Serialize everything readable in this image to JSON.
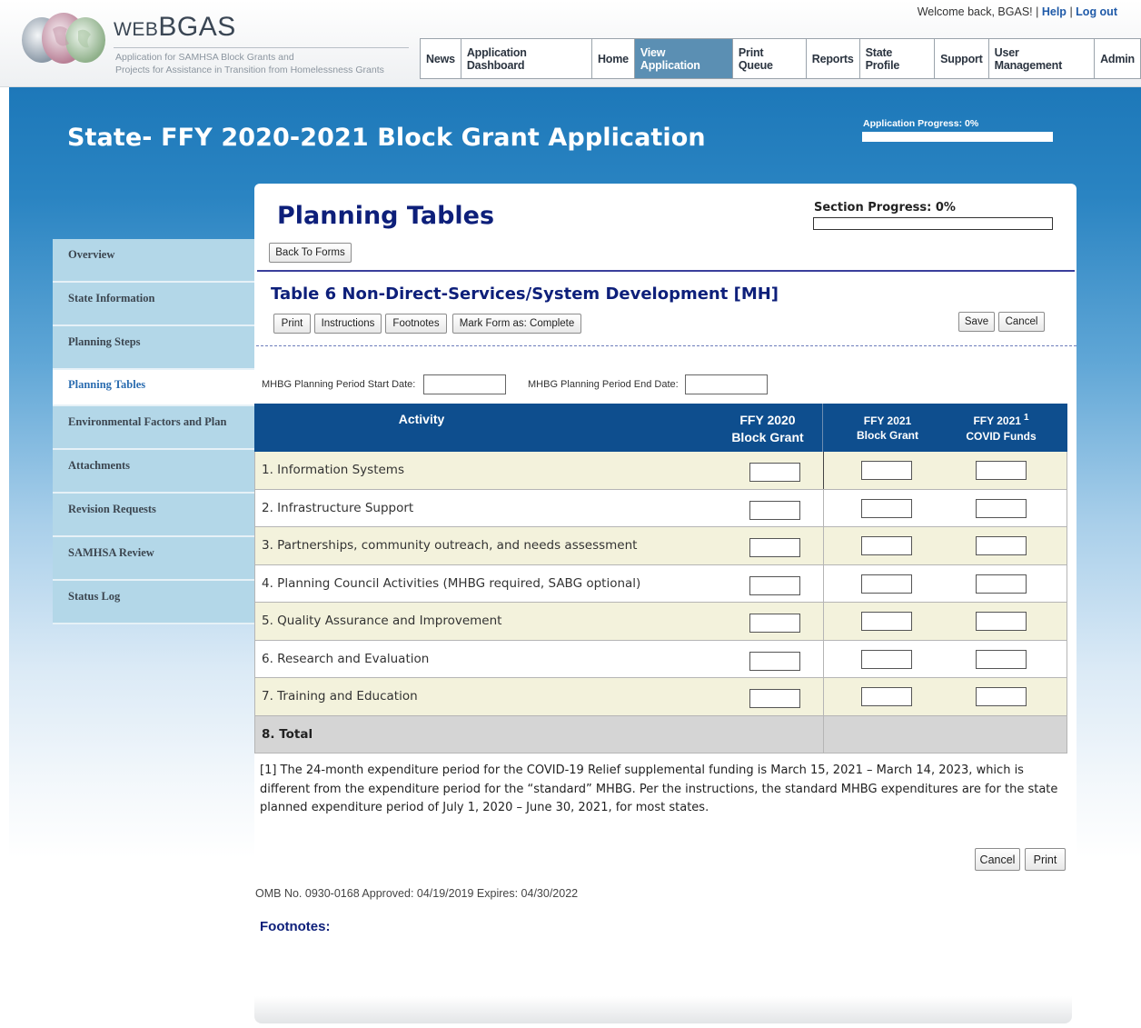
{
  "header": {
    "logo_title_prefix": "WEB",
    "logo_title_main": "BGAS",
    "logo_sub_line1": "Application for SAMHSA Block Grants and",
    "logo_sub_line2": "Projects for Assistance in Transition from Homelessness Grants",
    "welcome": "Welcome back, BGAS!",
    "help": "Help",
    "logout": "Log out",
    "nav": [
      "News",
      "Application Dashboard",
      "Home",
      "View Application",
      "Print Queue",
      "Reports",
      "State Profile",
      "Support",
      "User Management",
      "Admin"
    ],
    "active_nav": "View Application"
  },
  "application": {
    "title": "State- FFY 2020-2021 Block Grant Application",
    "progress_label": "Application Progress: 0%",
    "progress_value": 0
  },
  "sidebar": {
    "items": [
      "Overview",
      "State Information",
      "Planning Steps",
      "Planning Tables",
      "Environmental Factors and Plan",
      "Attachments",
      "Revision Requests",
      "SAMHSA Review",
      "Status Log"
    ],
    "active": "Planning Tables"
  },
  "section": {
    "title": "Planning Tables",
    "progress_label": "Section Progress: 0%",
    "progress_value": 0,
    "back_button": "Back To Forms"
  },
  "form": {
    "title": "Table 6 Non-Direct-Services/System Development [MH]",
    "buttons": {
      "print": "Print",
      "instructions": "Instructions",
      "footnotes": "Footnotes",
      "mark_complete": "Mark Form as: Complete",
      "save": "Save",
      "cancel": "Cancel"
    },
    "start_date_label": "MHBG Planning Period Start Date:",
    "start_date_value": "",
    "end_date_label": "MHBG Planning Period End Date:",
    "end_date_value": ""
  },
  "table": {
    "headers": {
      "activity": "Activity",
      "col1_line1": "FFY 2020",
      "col1_line2": "Block Grant",
      "col2_line1": "FFY 2021",
      "col2_line2": "Block Grant",
      "col3_line1": "FFY 2021",
      "col3_sup": "1",
      "col3_line2": "COVID Funds"
    },
    "rows": [
      {
        "label": "1. Information Systems",
        "values": [
          "",
          "",
          ""
        ]
      },
      {
        "label": "2. Infrastructure Support",
        "values": [
          "",
          "",
          ""
        ]
      },
      {
        "label": "3. Partnerships, community outreach, and needs assessment",
        "values": [
          "",
          "",
          ""
        ]
      },
      {
        "label": "4. Planning Council Activities (MHBG required, SABG optional)",
        "values": [
          "",
          "",
          ""
        ]
      },
      {
        "label": "5. Quality Assurance and Improvement",
        "values": [
          "",
          "",
          ""
        ]
      },
      {
        "label": "6. Research and Evaluation",
        "values": [
          "",
          "",
          ""
        ]
      },
      {
        "label": "7. Training and Education",
        "values": [
          "",
          "",
          ""
        ]
      }
    ],
    "total_label": "8. Total"
  },
  "footnote": "[1] The 24-month expenditure period for the COVID-19 Relief supplemental funding is March 15, 2021 – March 14, 2023, which is different from the expenditure period for the “standard” MHBG. Per the instructions, the standard MHBG expenditures are for the state planned expenditure period of July 1, 2020 – June 30, 2021, for most states.",
  "bottom_buttons": {
    "cancel": "Cancel",
    "print": "Print"
  },
  "omb": "OMB No. 0930-0168 Approved: 04/19/2019 Expires: 04/30/2022",
  "footnotes_heading": "Footnotes:"
}
